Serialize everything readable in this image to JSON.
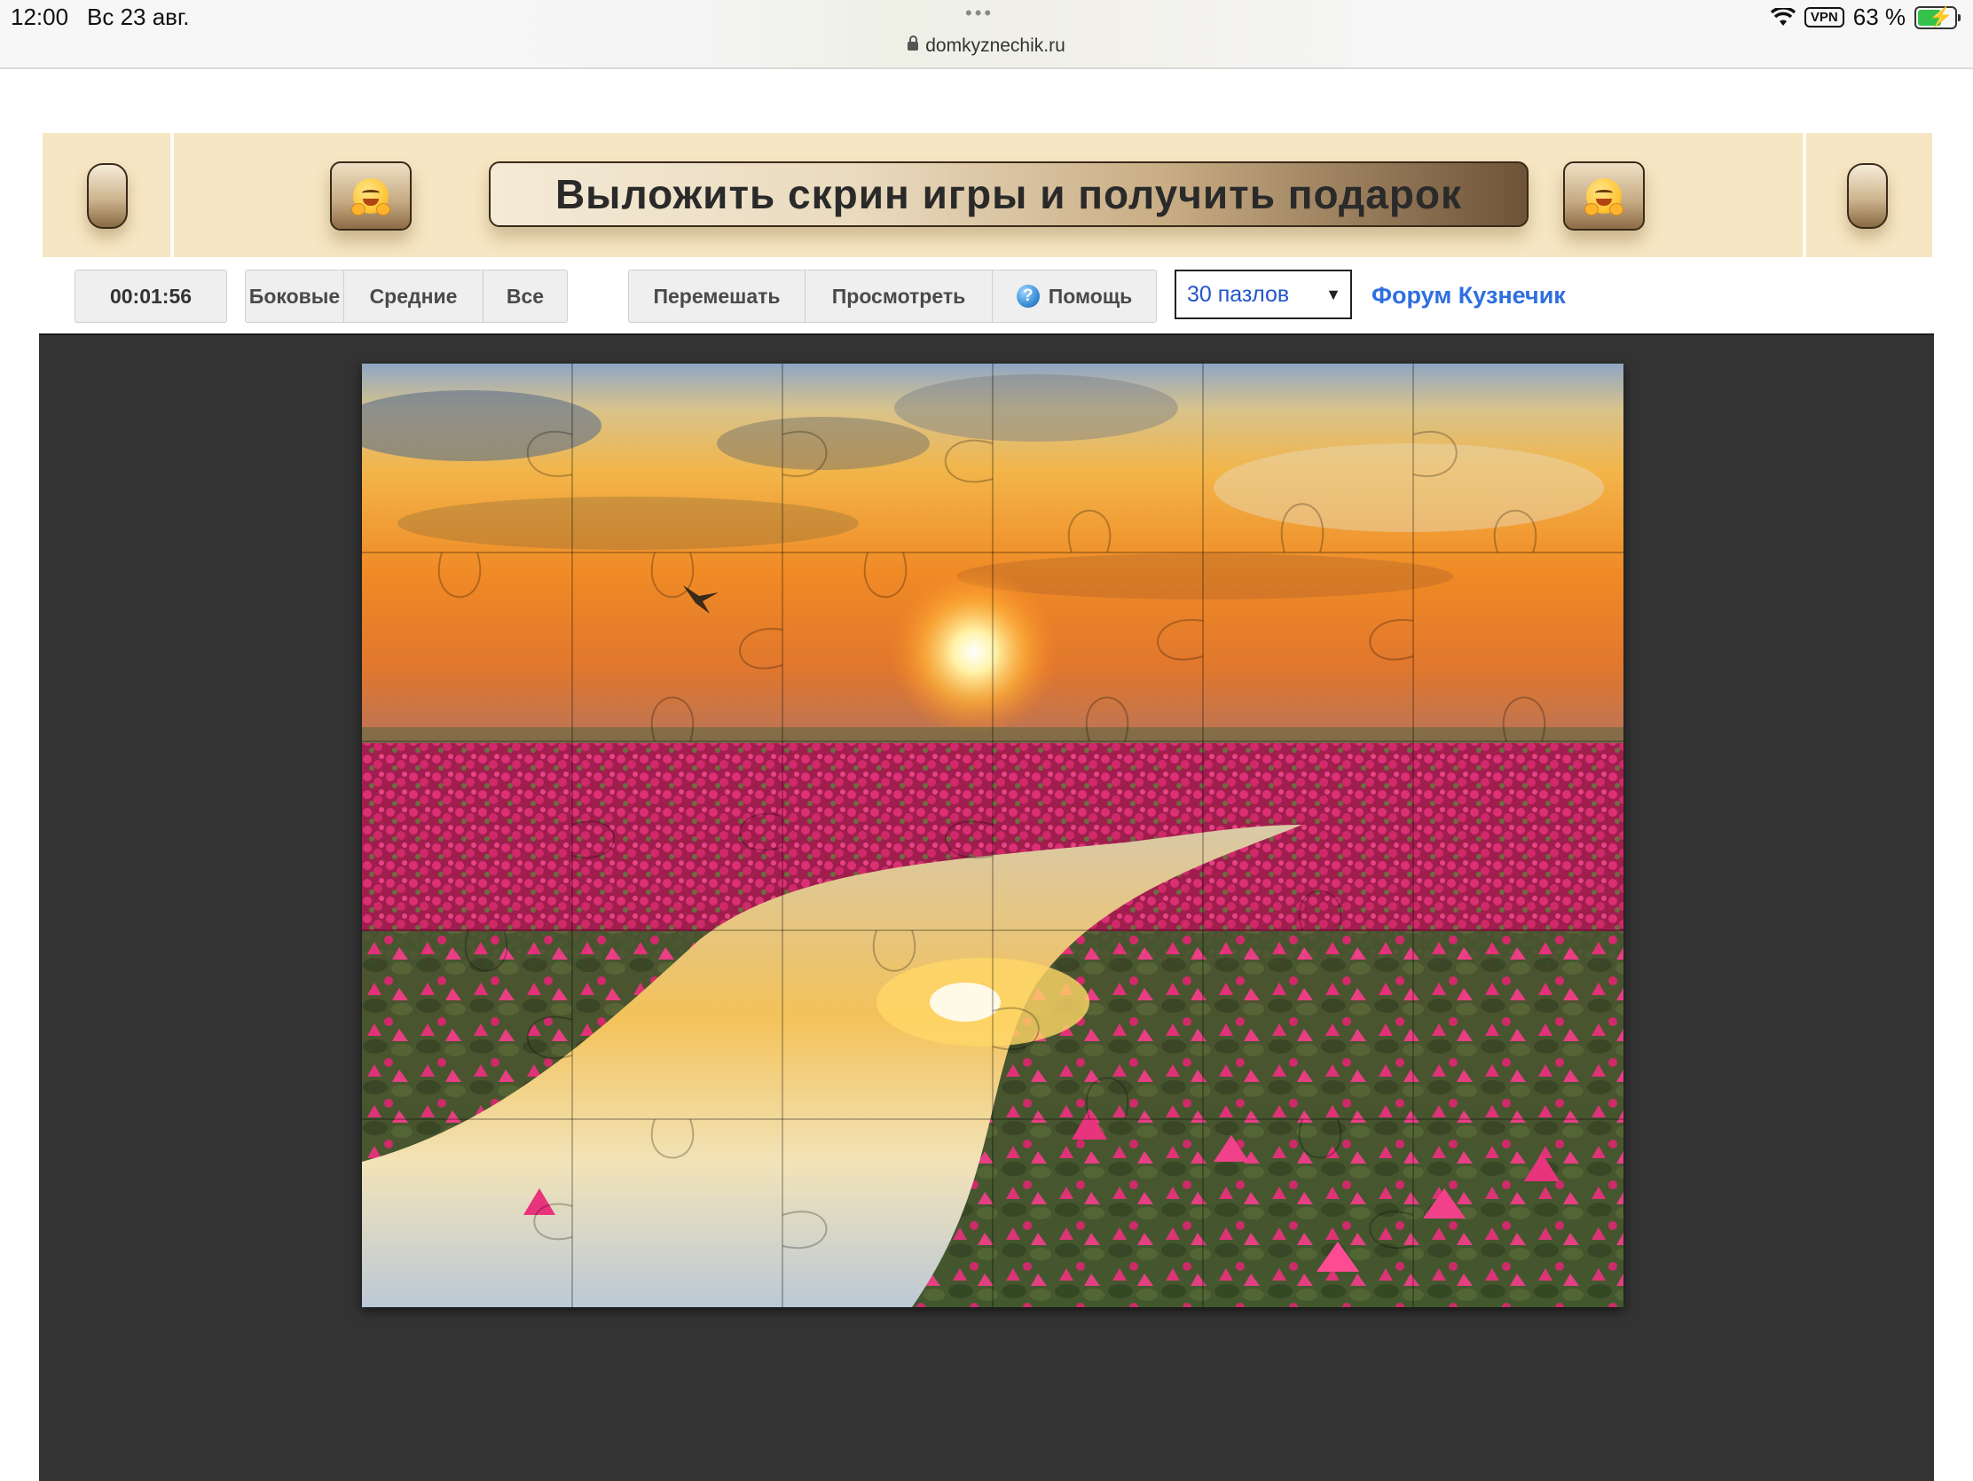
{
  "status_bar": {
    "time": "12:00",
    "date": "Вс 23 авг.",
    "url": "domkyznechik.ru",
    "vpn": "VPN",
    "battery": "63 %"
  },
  "banner": {
    "cta_text": "Выложить скрин игры и получить подарок"
  },
  "toolbar": {
    "timer": "00:01:56",
    "filter_buttons": [
      "Боковые",
      "Средние",
      "Все"
    ],
    "action_buttons": [
      "Перемешать",
      "Просмотреть",
      "Помощь"
    ],
    "pieces_select": "30 пазлов",
    "forum_link": "Форум Кузнечик"
  },
  "puzzle": {
    "columns": 6,
    "rows": 5,
    "piece_count": 30
  },
  "colors": {
    "stage_bg": "#333333",
    "banner_bg": "#f6e6c3",
    "link": "#2f6fe0",
    "select_text": "#2255cc"
  }
}
